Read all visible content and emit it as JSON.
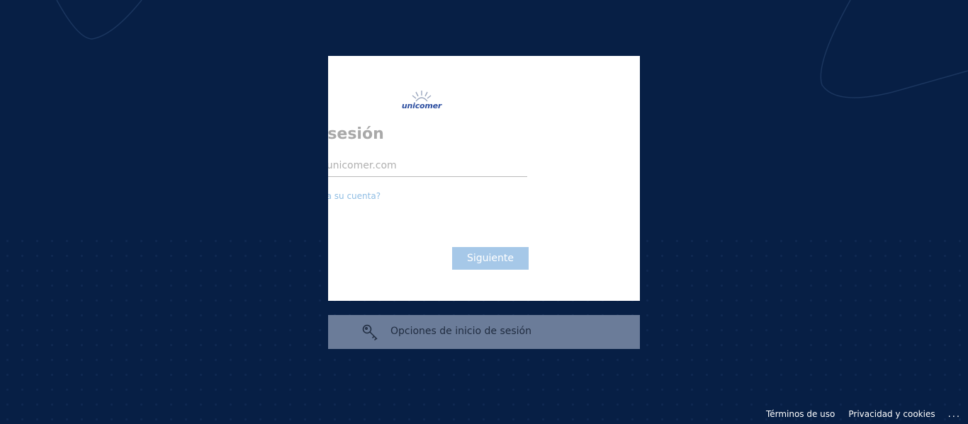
{
  "logo": {
    "brand_text": "unicomer",
    "icon": "unicomer-sun-logo"
  },
  "signin_card": {
    "title": "Iniciar sesión",
    "email_value": "jnoque@unicomer.com",
    "cant_access_link": "¿No puede acceder a su cuenta?",
    "next_button": "Siguiente"
  },
  "signin_options": {
    "icon": "key-icon",
    "label": "Opciones de inicio de sesión"
  },
  "footer": {
    "terms": "Términos de uso",
    "privacy": "Privacidad y cookies",
    "more": "..."
  },
  "colors": {
    "background": "#071f45",
    "card": "#ffffff",
    "button": "#a6c8e8",
    "link": "#8fbde4",
    "options_bar": "#6b7c99"
  }
}
